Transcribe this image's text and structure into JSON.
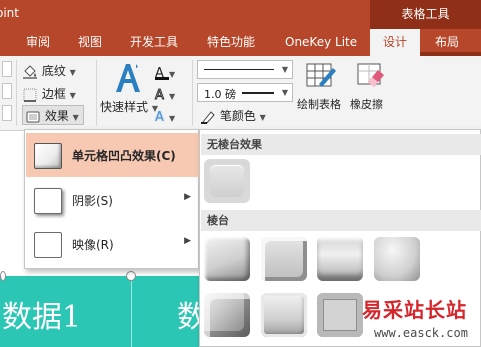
{
  "app": {
    "title": "oint"
  },
  "contextual_group": {
    "label": "表格工具"
  },
  "tabs": [
    {
      "label": "审阅"
    },
    {
      "label": "视图"
    },
    {
      "label": "开发工具"
    },
    {
      "label": "特色功能"
    },
    {
      "label": "OneKey Lite"
    },
    {
      "label": "设计",
      "active": true
    },
    {
      "label": "布局"
    }
  ],
  "ribbon": {
    "shading_label": "底纹",
    "border_label": "边框",
    "effects_label": "效果",
    "quick_styles_label": "快速样式",
    "pen_weight_value": "1.0 磅",
    "pen_color_label": "笔颜色",
    "draw_table_label": "绘制表格",
    "eraser_label": "橡皮擦"
  },
  "effects_menu": {
    "items": [
      {
        "label": "单元格凹凸效果(C)",
        "highlighted": true
      },
      {
        "label": "阴影(S)",
        "highlighted": false
      },
      {
        "label": "映像(R)",
        "highlighted": false
      }
    ]
  },
  "bevel_gallery": {
    "no_bevel_header": "无棱台效果",
    "bevel_header": "棱台"
  },
  "slide": {
    "cell_text_1": "数据1",
    "cell_text_2": "数"
  },
  "watermark": {
    "cn_text": "易采站长站",
    "url": "www.easck.com"
  },
  "colors": {
    "title_bar": "#b7472a",
    "contextual_tab": "#8f2f17",
    "highlight": "#f7c9b3",
    "table_band": "#2bc6b4",
    "watermark_red": "#d4262d"
  }
}
